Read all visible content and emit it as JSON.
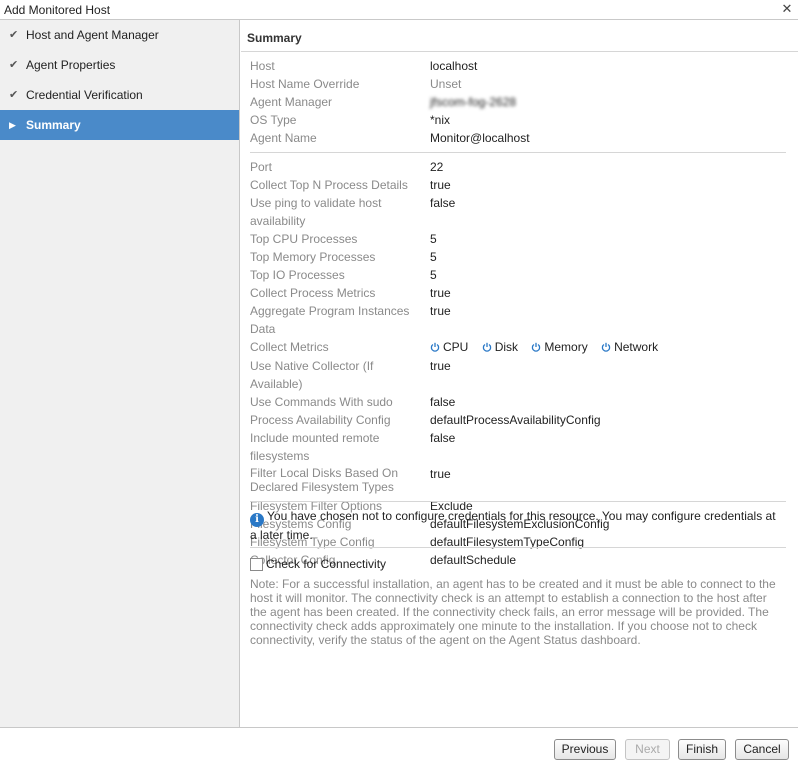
{
  "window": {
    "title": "Add Monitored Host"
  },
  "sidebar": {
    "items": [
      {
        "label": "Host and Agent Manager",
        "state": "done"
      },
      {
        "label": "Agent Properties",
        "state": "done"
      },
      {
        "label": "Credential Verification",
        "state": "done"
      },
      {
        "label": "Summary",
        "state": "active"
      }
    ]
  },
  "summary": {
    "title": "Summary",
    "host_group": [
      {
        "key": "Host",
        "value": "localhost"
      },
      {
        "key": "Host Name Override",
        "value": "Unset"
      },
      {
        "key": "Agent Manager",
        "value": "jfscom-fog-2628"
      },
      {
        "key": "OS Type",
        "value": "*nix"
      },
      {
        "key": "Agent Name",
        "value": "Monitor@localhost"
      }
    ],
    "props": {
      "port": {
        "key": "Port",
        "value": "22"
      },
      "top_n": {
        "key": "Collect Top N Process Details",
        "value": "true"
      },
      "ping": {
        "key": "Use ping to validate host availability",
        "value": "false"
      },
      "top_cpu": {
        "key": "Top CPU Processes",
        "value": "5"
      },
      "top_mem": {
        "key": "Top Memory Processes",
        "value": "5"
      },
      "top_io": {
        "key": "Top IO Processes",
        "value": "5"
      },
      "proc_metrics": {
        "key": "Collect Process Metrics",
        "value": "true"
      },
      "aggregate": {
        "key": "Aggregate Program Instances Data",
        "value": "true"
      },
      "collect_metrics": {
        "key": "Collect Metrics",
        "metrics": [
          "CPU",
          "Disk",
          "Memory",
          "Network"
        ]
      },
      "native": {
        "key": "Use Native Collector (If Available)",
        "value": "true"
      },
      "sudo": {
        "key": "Use Commands With sudo",
        "value": "false"
      },
      "proc_avail": {
        "key": "Process Availability Config",
        "value": "defaultProcessAvailabilityConfig"
      },
      "mounted": {
        "key": "Include mounted remote filesystems",
        "value": "false"
      },
      "filter_disks": {
        "key": "Filter Local Disks Based On Declared Filesystem Types",
        "value": "true"
      },
      "fs_filter": {
        "key": "Filesystem Filter Options",
        "value": "Exclude"
      },
      "fs_config": {
        "key": "Filesystems Config",
        "value": "defaultFilesystemExclusionConfig"
      },
      "fs_type": {
        "key": "Filesystem Type Config",
        "value": "defaultFilesystemTypeConfig"
      },
      "collector": {
        "key": "Collector Config",
        "value": "defaultSchedule"
      }
    },
    "info_text": "You have chosen not to configure credentials for this resource. You may configure credentials at a later time.",
    "check_label": "Check for Connectivity",
    "check_checked": false,
    "note": "Note: For a successful installation, an agent has to be created and it must be able to connect to the host it will monitor. The connectivity check is an attempt to establish a connection to the host after the agent has been created. If the connectivity check fails, an error message will be provided. The connectivity check adds approximately one minute to the installation. If you choose not to check connectivity, verify the status of the agent on the Agent Status dashboard."
  },
  "footer": {
    "previous": "Previous",
    "next": "Next",
    "finish": "Finish",
    "cancel": "Cancel"
  },
  "colors": {
    "accent": "#4a8ac9",
    "label_gray": "#8a8a8a",
    "info_blue": "#2a78c6"
  }
}
